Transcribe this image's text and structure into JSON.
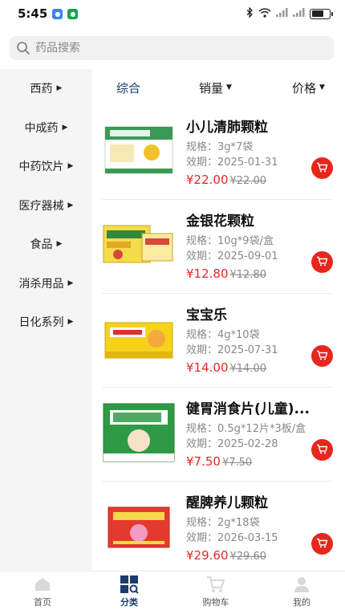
{
  "status_bar": {
    "time": "5:45"
  },
  "search": {
    "placeholder": "药品搜索"
  },
  "sidebar": {
    "items": [
      {
        "label": "西药"
      },
      {
        "label": "中成药"
      },
      {
        "label": "中药饮片"
      },
      {
        "label": "医疗器械"
      },
      {
        "label": "食品"
      },
      {
        "label": "消杀用品"
      },
      {
        "label": "日化系列"
      }
    ]
  },
  "sort": {
    "comprehensive": "综合",
    "sales": "销量",
    "price": "价格"
  },
  "products": [
    {
      "name": "小儿清肺颗粒",
      "spec": "规格：3g*7袋",
      "expiry": "效期：2025-01-31",
      "price": "¥22.00",
      "old_price": "¥22.00"
    },
    {
      "name": "金银花颗粒",
      "spec": "规格：10g*9袋/盒",
      "expiry": "效期：2025-09-01",
      "price": "¥12.80",
      "old_price": "¥12.80"
    },
    {
      "name": "宝宝乐",
      "spec": "规格：4g*10袋",
      "expiry": "效期：2025-07-31",
      "price": "¥14.00",
      "old_price": "¥14.00"
    },
    {
      "name": "健胃消食片(儿童)...",
      "spec": "规格：0.5g*12片*3板/盒",
      "expiry": "效期：2025-02-28",
      "price": "¥7.50",
      "old_price": "¥7.50"
    },
    {
      "name": "醒脾养儿颗粒",
      "spec": "规格：2g*18袋",
      "expiry": "效期：2026-03-15",
      "price": "¥29.60",
      "old_price": "¥29.60"
    }
  ],
  "bottom_nav": {
    "home": "首页",
    "category": "分类",
    "cart": "购物车",
    "mine": "我的"
  },
  "colors": {
    "accent": "#1a3d6d",
    "price": "#e02a26",
    "cart_button": "#e8261d",
    "sidebar_bg": "#f5f5f5"
  }
}
